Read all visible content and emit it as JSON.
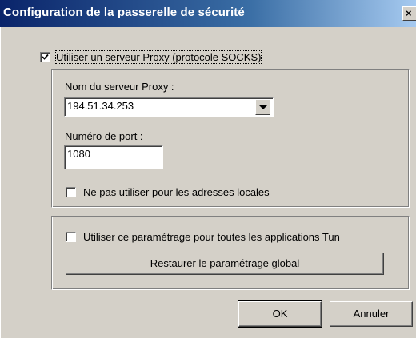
{
  "window": {
    "title": "Configuration de la passerelle de sécurité",
    "close_glyph": "×"
  },
  "proxy": {
    "use_proxy_label": "Utiliser un serveur Proxy (protocole SOCKS)",
    "use_proxy_checked": true,
    "server_label": "Nom du serveur Proxy :",
    "server_value": "194.51.34.253",
    "port_label": "Numéro de port :",
    "port_value": "1080",
    "no_local_label": "Ne pas utiliser pour les adresses locales",
    "no_local_checked": false
  },
  "global": {
    "apply_all_label": "Utiliser ce paramétrage pour toutes les applications Tun",
    "apply_all_checked": false,
    "restore_label": "Restaurer le paramétrage global"
  },
  "buttons": {
    "ok_label": "OK",
    "cancel_label": "Annuler"
  },
  "icons": {
    "checkmark": "checkmark-icon",
    "dropdown": "chevron-down-icon",
    "close": "close-icon"
  }
}
